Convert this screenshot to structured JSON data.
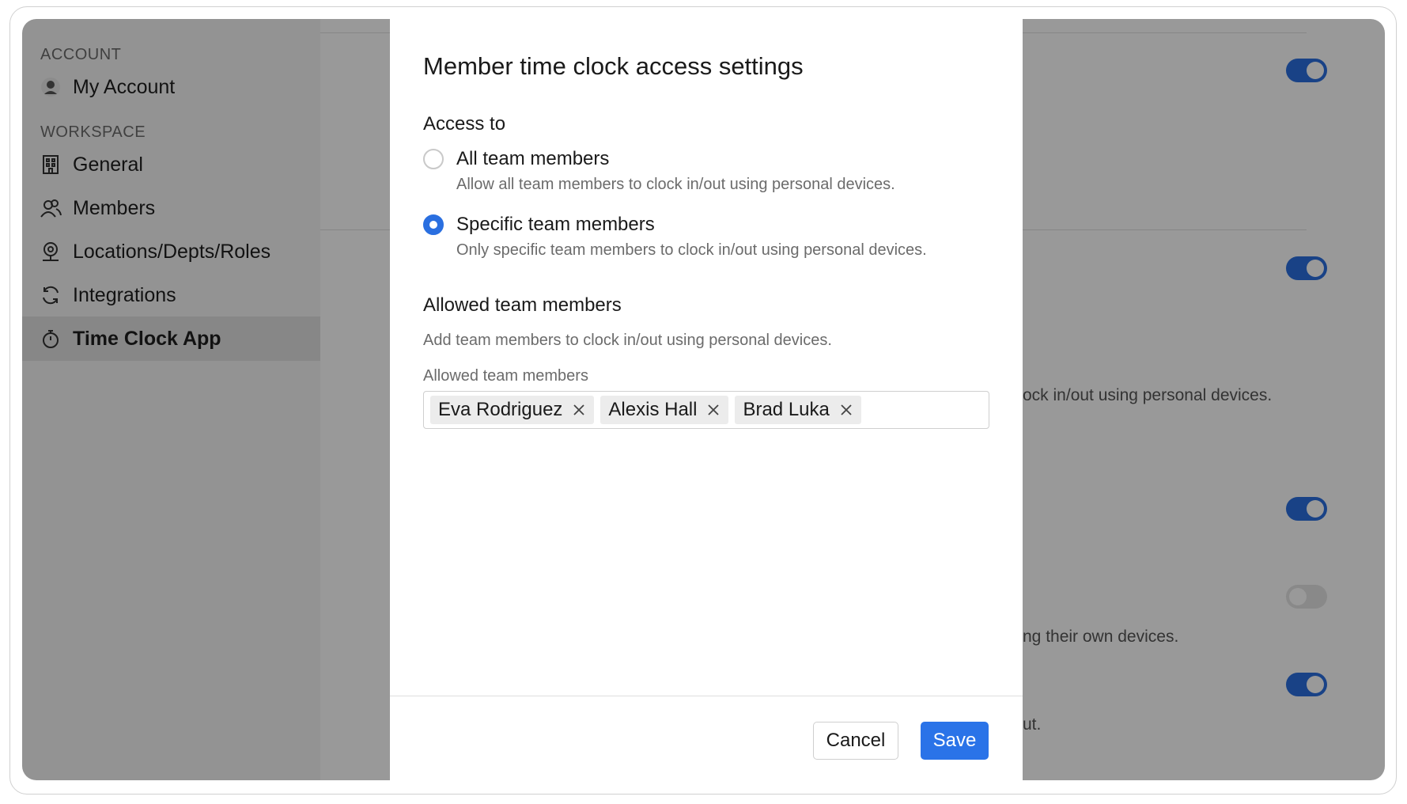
{
  "sidebar": {
    "account_label": "ACCOUNT",
    "workspace_label": "WORKSPACE",
    "items": [
      {
        "label": "My Account",
        "icon": "avatar-icon"
      },
      {
        "label": "General",
        "icon": "building-icon"
      },
      {
        "label": "Members",
        "icon": "members-icon"
      },
      {
        "label": "Locations/Depts/Roles",
        "icon": "location-icon"
      },
      {
        "label": "Integrations",
        "icon": "sync-icon"
      },
      {
        "label": "Time Clock App",
        "icon": "stopwatch-icon",
        "active": true
      }
    ]
  },
  "background": {
    "snippet_1": "ock in/out using personal devices.",
    "snippet_2": "ng their own devices.",
    "snippet_3": "ut.",
    "toggles": [
      {
        "state": "on"
      },
      {
        "state": "on"
      },
      {
        "state": "on"
      },
      {
        "state": "off"
      },
      {
        "state": "on"
      }
    ]
  },
  "modal": {
    "title": "Member time clock access settings",
    "access_heading": "Access to",
    "options": [
      {
        "label": "All team members",
        "description": "Allow all team members to clock in/out using personal devices.",
        "checked": false
      },
      {
        "label": "Specific team members",
        "description": "Only specific team members to clock in/out using personal devices.",
        "checked": true
      }
    ],
    "allowed_heading": "Allowed team members",
    "allowed_helper": "Add team members to clock in/out using personal devices.",
    "field_label": "Allowed team members",
    "chips": [
      "Eva Rodriguez",
      "Alexis Hall",
      "Brad Luka"
    ],
    "cancel_label": "Cancel",
    "save_label": "Save"
  },
  "colors": {
    "accent": "#2a73e8",
    "overlay": "rgba(0,0,0,0.40)"
  }
}
